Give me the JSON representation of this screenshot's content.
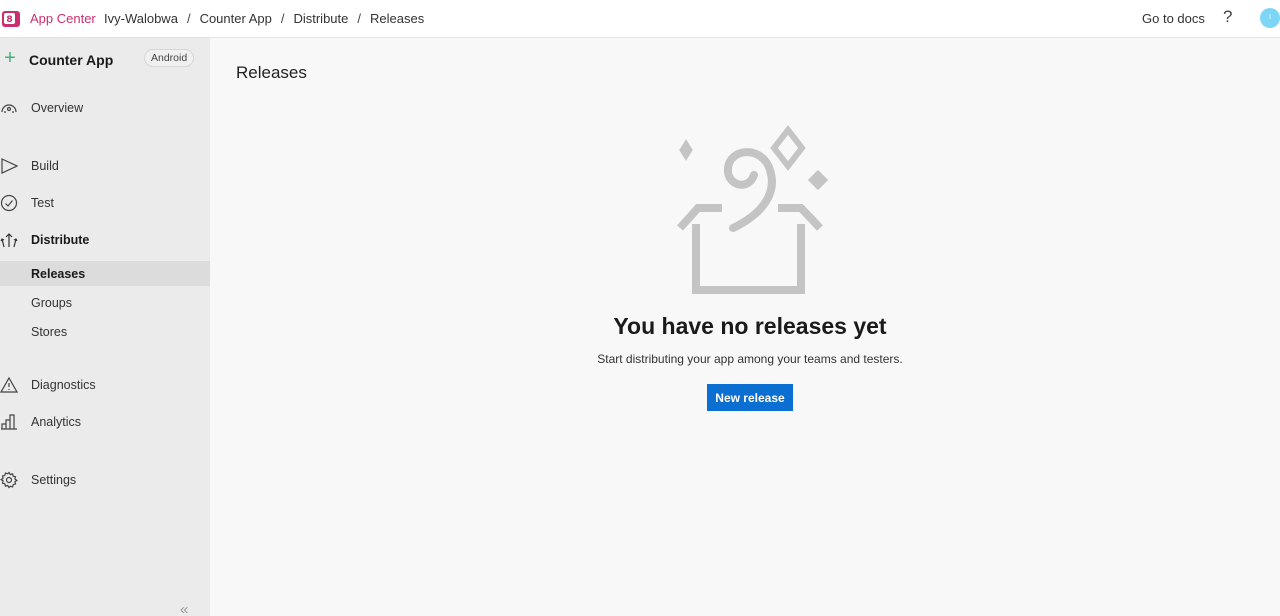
{
  "header": {
    "brand": "App Center",
    "breadcrumbs": [
      "Ivy-Walobwa",
      "Counter App",
      "Distribute",
      "Releases"
    ],
    "separator": "/",
    "docs_link": "Go to docs",
    "help_icon": "?",
    "avatar_initial": "I",
    "brand_color": "#cb2e6d"
  },
  "sidebar": {
    "app_name": "Counter App",
    "platform": "Android",
    "items": [
      {
        "label": "Overview",
        "icon": "dashboard-icon"
      },
      {
        "label": "Build",
        "icon": "play-icon"
      },
      {
        "label": "Test",
        "icon": "check-circle-icon"
      },
      {
        "label": "Distribute",
        "icon": "distribute-icon"
      },
      {
        "label": "Diagnostics",
        "icon": "warning-icon"
      },
      {
        "label": "Analytics",
        "icon": "bar-chart-icon"
      },
      {
        "label": "Settings",
        "icon": "gear-icon"
      }
    ],
    "sub_items": [
      {
        "label": "Releases",
        "active": true
      },
      {
        "label": "Groups",
        "active": false
      },
      {
        "label": "Stores",
        "active": false
      }
    ],
    "collapse_icon": "«"
  },
  "main": {
    "title": "Releases",
    "empty_title": "You have no releases yet",
    "empty_subtitle": "Start distributing your app among your teams and testers.",
    "new_release_label": "New release",
    "button_color": "#0a6fd0"
  }
}
